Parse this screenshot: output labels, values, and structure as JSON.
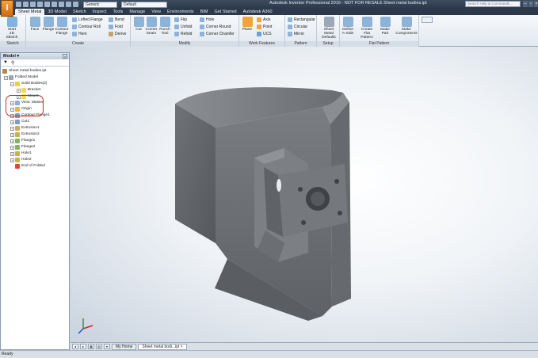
{
  "titlebar": {
    "app_button": "I",
    "style_select": "Generic",
    "appearance_select": "Default",
    "title": "Autodesk Inventor Professional 2016 - NOT FOR RESALE   Sheet metal bodies.ipt",
    "help_search_placeholder": "Search Help & Commands...",
    "min": "–",
    "max": "▫",
    "close": "×"
  },
  "tabs": [
    "Sheet Metal",
    "3D Model",
    "Sketch",
    "Inspect",
    "Tools",
    "Manage",
    "View",
    "Environments",
    "BIM",
    "Get Started",
    "Autodesk A360"
  ],
  "ribbon": {
    "sketch": {
      "label": "Sketch",
      "start_sketch": "Start",
      "start_sketch_2": "2D Sketch"
    },
    "create": {
      "label": "Create",
      "face": "Face",
      "flange": "Flange",
      "contour": "Contour",
      "contour_2": "Flange",
      "lofted_flange": "Lofted Flange",
      "contour_roll": "Contour Roll",
      "hem": "Hem",
      "bend": "Bend",
      "fold": "Fold",
      "derive": "Derive"
    },
    "modify": {
      "label": "Modify",
      "cut": "Cut",
      "corner_seam": "Corner",
      "corner_seam_2": "Seam",
      "punch_tool": "Punch",
      "punch_tool_2": "Tool",
      "flip": "Flip",
      "unfold": "Unfold",
      "refold": "Refold",
      "hole": "Hole",
      "corner_round": "Corner Round",
      "corner_chamfer": "Corner Chamfer"
    },
    "work_features": {
      "label": "Work Features",
      "plane": "Plane",
      "axis": "Axis",
      "point": "Point",
      "ucs": "UCS"
    },
    "pattern": {
      "label": "Pattern",
      "rectangular": "Rectangular",
      "circular": "Circular",
      "mirror": "Mirror"
    },
    "setup": {
      "label": "Setup",
      "defaults": "Sheet Metal",
      "defaults_2": "Defaults"
    },
    "flat_pattern": {
      "label": "Flat Pattern",
      "define_a_side": "Define",
      "define_a_side_2": "A-Side",
      "create_flat": "Create",
      "create_flat_2": "Flat Pattern",
      "make_part": "Make",
      "make_part_2": "Part",
      "make_components": "Make",
      "make_components_2": "Components"
    }
  },
  "browser": {
    "title": "Model ▾",
    "close": "×",
    "filter_icon": "▼",
    "search_icon": "⚲",
    "tree": [
      {
        "label": "Sheet metal bodies.ipt",
        "indent": 0
      },
      {
        "label": "Folded Model",
        "indent": 1
      },
      {
        "label": "Solid Bodies(2)",
        "indent": 2
      },
      {
        "label": "Bracket",
        "indent": 3
      },
      {
        "label": "Mount",
        "indent": 3
      },
      {
        "label": "View: Master",
        "indent": 2
      },
      {
        "label": "Origin",
        "indent": 2
      },
      {
        "label": "Contour Flange1",
        "indent": 2
      },
      {
        "label": "Cut1",
        "indent": 2
      },
      {
        "label": "Extrusion1",
        "indent": 2
      },
      {
        "label": "Extrusion2",
        "indent": 2
      },
      {
        "label": "Flange1",
        "indent": 2
      },
      {
        "label": "Flange2",
        "indent": 2
      },
      {
        "label": "Hole1",
        "indent": 2
      },
      {
        "label": "Hole2",
        "indent": 2
      },
      {
        "label": "End of Folded",
        "indent": 2
      }
    ]
  },
  "doctabs": {
    "home": "My Home",
    "active": "Sheet metal bodi...ipt",
    "close": "×"
  },
  "status": "Ready",
  "colors": {
    "accent": "#e8882a",
    "part_grey": "#6e7175",
    "highlight": "#d42424"
  }
}
